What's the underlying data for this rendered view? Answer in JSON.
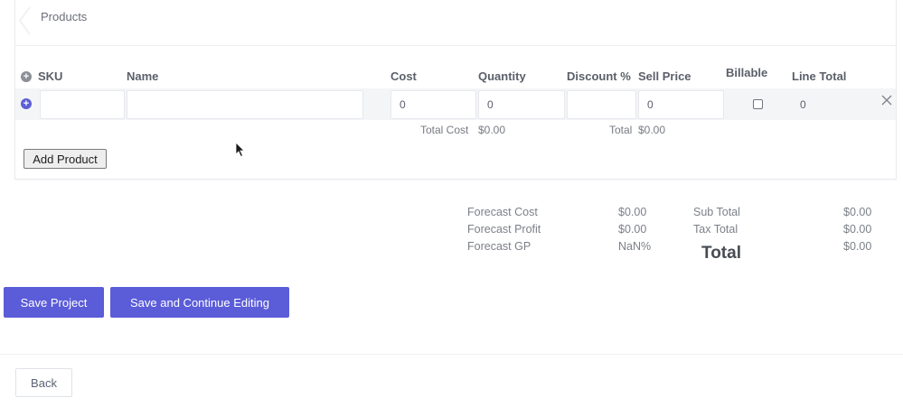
{
  "products": {
    "title": "Products",
    "columns": {
      "sku": "SKU",
      "name": "Name",
      "cost": "Cost",
      "quantity": "Quantity",
      "discount": "Discount %",
      "sell_price": "Sell Price",
      "billable": "Billable",
      "line_total": "Line Total"
    },
    "row": {
      "sku": "",
      "name": "",
      "cost": "0",
      "quantity": "0",
      "discount": "",
      "sell_price": "0",
      "billable": false,
      "line_total": "0"
    },
    "totals": {
      "total_cost_label": "Total Cost",
      "total_cost_value": "$0.00",
      "total_label": "Total",
      "total_value": "$0.00"
    },
    "add_product_label": "Add Product"
  },
  "summary": {
    "forecast_cost_label": "Forecast Cost",
    "forecast_cost_value": "$0.00",
    "forecast_profit_label": "Forecast Profit",
    "forecast_profit_value": "$0.00",
    "forecast_gp_label": "Forecast GP",
    "forecast_gp_value": "NaN%",
    "sub_total_label": "Sub Total",
    "sub_total_value": "$0.00",
    "tax_total_label": "Tax Total",
    "tax_total_value": "$0.00",
    "total_label": "Total",
    "total_value": "$0.00"
  },
  "actions": {
    "save_project": "Save Project",
    "save_continue": "Save and Continue Editing",
    "back": "Back"
  },
  "colors": {
    "primary": "#5b5cd8",
    "row_background": "#f4f5f7",
    "border": "#e6e8ec"
  },
  "icons": {
    "add_column": "plus-circle-grey",
    "add_row": "plus-circle-blue",
    "remove_row": "close-x",
    "pointer": "mouse-cursor"
  }
}
